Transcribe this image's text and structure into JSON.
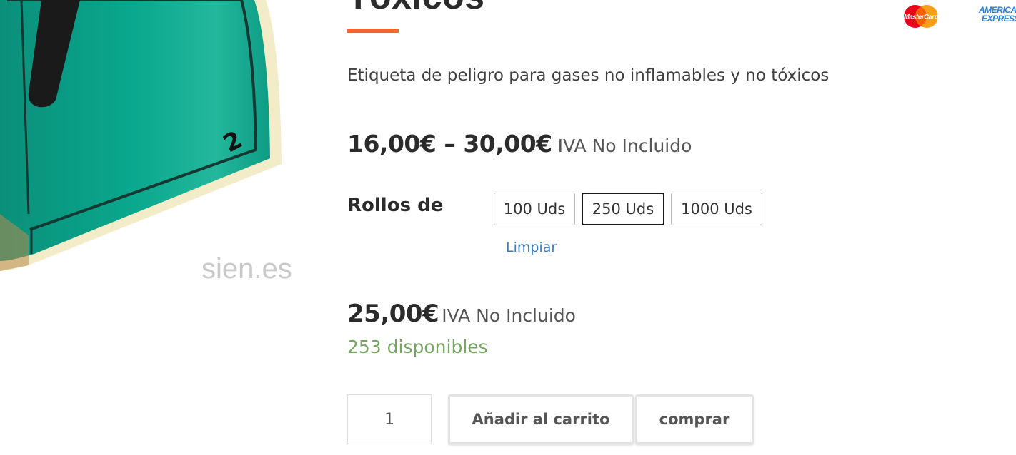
{
  "product": {
    "title": "Tóxicos",
    "description": "Etiqueta de peligro para gases no inflamables y no tóxicos",
    "image_label": "2",
    "image_watermark": "sien.es",
    "price_range": {
      "amount": "16,00€ – 30,00€",
      "tax_note": "IVA No Incluido"
    },
    "variation": {
      "label": "Rollos de",
      "options": [
        "100 Uds",
        "250 Uds",
        "1000 Uds"
      ],
      "selected": "250 Uds",
      "clear_label": "Limpiar"
    },
    "variation_price": {
      "amount": "25,00€",
      "tax_note": "IVA No Incluido"
    },
    "stock": "253 disponibles",
    "quantity": "1",
    "add_to_cart_label": "Añadir al carrito",
    "buy_label": "comprar"
  },
  "payment_logos": {
    "mastercard": "MasterCard",
    "amex_line1": "AMERICAN",
    "amex_line2": "EXPRESS"
  },
  "colors": {
    "accent": "#f26430",
    "stock": "#77a464",
    "link": "#3a7bc0",
    "label_teal": "#0aa189"
  }
}
